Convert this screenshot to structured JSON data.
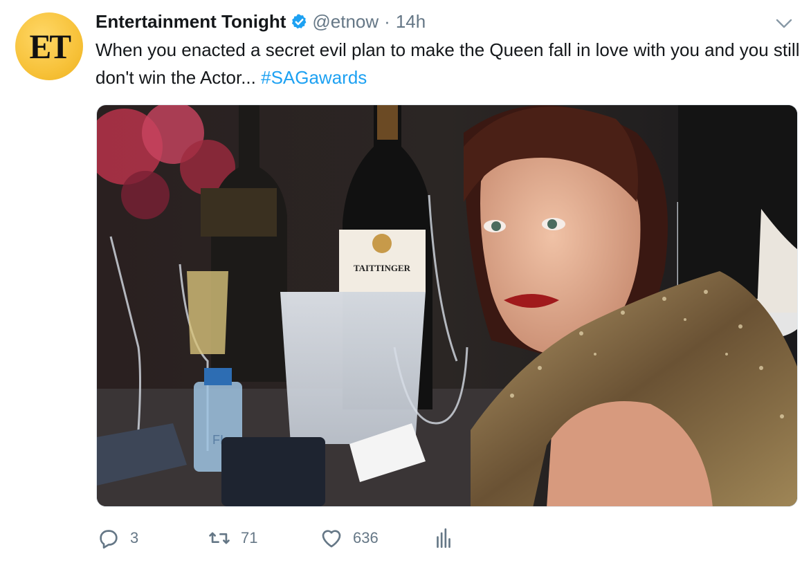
{
  "account": {
    "logo_text": "ET",
    "name": "Entertainment Tonight",
    "handle": "@etnow",
    "separator": "·",
    "time": "14h",
    "verified": true
  },
  "tweet": {
    "text": "When you enacted a secret evil plan to make the Queen fall in love with you and you still don't win the Actor... ",
    "hashtag": "#SAGawards"
  },
  "media": {
    "bottle_label": "TAITTINGER",
    "water_label": "FI"
  },
  "actions": {
    "reply_count": "3",
    "retweet_count": "71",
    "like_count": "636"
  },
  "icons": {
    "verified": "verified-badge-icon",
    "caret": "chevron-down-icon",
    "reply": "reply-icon",
    "retweet": "retweet-icon",
    "like": "heart-icon",
    "analytics": "analytics-icon"
  },
  "colors": {
    "link": "#1da1f2",
    "muted": "#657786",
    "text": "#14171a",
    "logo": "#f7c23a"
  }
}
